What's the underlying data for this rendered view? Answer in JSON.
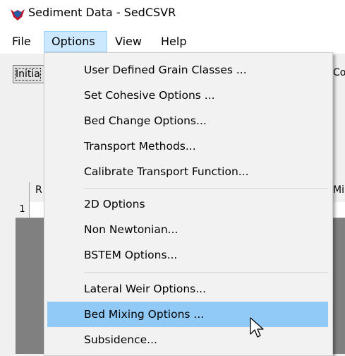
{
  "window": {
    "title": "Sediment Data - SedCSVR"
  },
  "menubar": {
    "items": [
      "File",
      "Options",
      "View",
      "Help"
    ]
  },
  "background": {
    "button_label": "Initia",
    "right_label": "Co",
    "grid": {
      "header_col1": "R",
      "header_col_right": "Mi",
      "row1_num": "1"
    }
  },
  "options_menu": {
    "items": [
      "User Defined Grain Classes ...",
      "Set Cohesive Options ...",
      "Bed Change Options...",
      "Transport Methods...",
      "Calibrate Transport Function...",
      "2D Options",
      "Non Newtonian...",
      "BSTEM Options...",
      "Lateral Weir Options...",
      "Bed Mixing Options ...",
      "Subsidence..."
    ],
    "highlighted": "Bed Mixing Options ..."
  },
  "colors": {
    "menu_highlight": "#91c9f7",
    "menubar_active": "#cce8ff",
    "icon": "#c0162b"
  }
}
